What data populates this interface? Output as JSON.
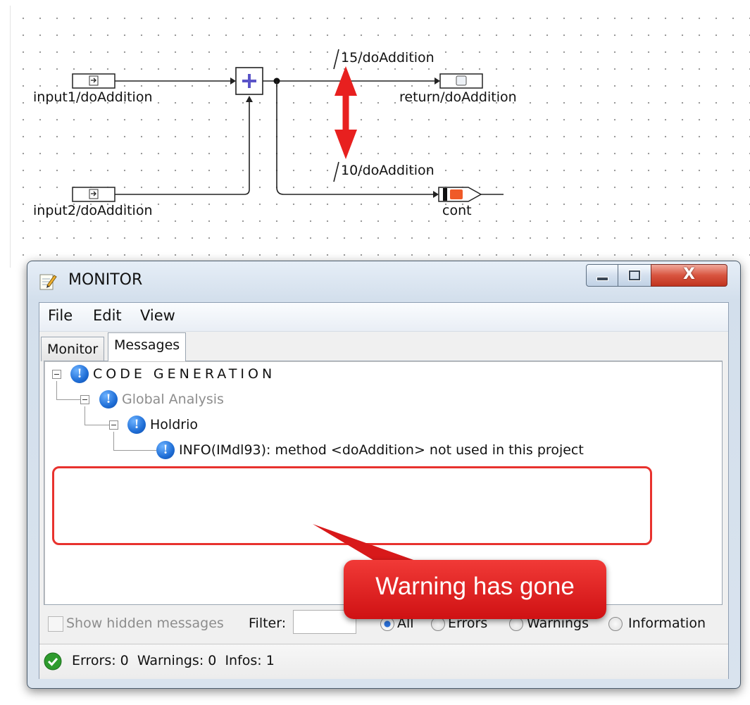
{
  "diagram": {
    "nodes": {
      "input1": "input1/doAddition",
      "input2": "input2/doAddition",
      "return": "return/doAddition",
      "cont": "cont"
    },
    "annotations": {
      "top": "15/doAddition",
      "bottom": "10/doAddition"
    }
  },
  "window": {
    "title": "MONITOR",
    "close_glyph": "X",
    "menu": [
      "File",
      "Edit",
      "View"
    ],
    "tabs": [
      "Monitor",
      "Messages"
    ],
    "active_tab": "Messages"
  },
  "messages": {
    "root": "CODE GENERATION",
    "child": "Global Analysis",
    "grandchild": "Holdrio",
    "leaf": "INFO(IMdl93): method <doAddition> not used in this project"
  },
  "callout": {
    "text": "Warning has gone",
    "color": "#e8201f"
  },
  "filter": {
    "show_hidden_label": "Show hidden messages",
    "filter_label": "Filter:",
    "filter_value": "",
    "options": [
      "All",
      "Errors",
      "Warnings",
      "Information"
    ],
    "selected": "All"
  },
  "status": {
    "text": "Errors: 0  Warnings: 0  Infos: 1",
    "icon": "check-circle-icon",
    "icon_color": "#2e9b2e"
  }
}
